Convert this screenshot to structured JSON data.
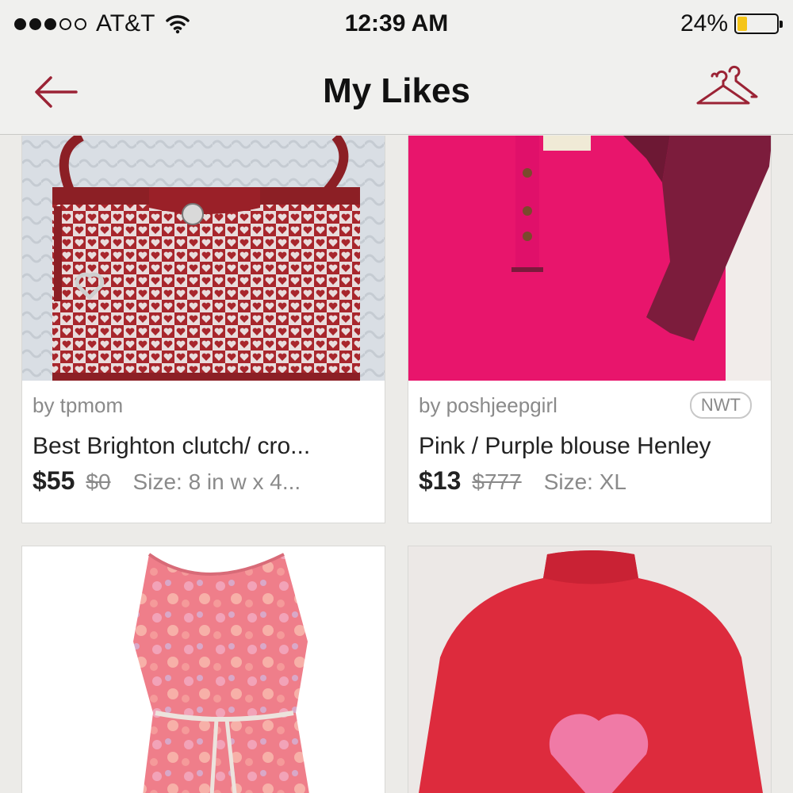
{
  "status_bar": {
    "carrier": "AT&T",
    "time": "12:39 AM",
    "battery": "24%",
    "battery_level": 0.24,
    "signal_bars": 3,
    "signal_total": 5
  },
  "header": {
    "title": "My Likes",
    "back_icon": "arrow-left-icon",
    "closet_icon": "hangers-icon"
  },
  "colors": {
    "accent": "#9b2335",
    "battery_fill": "#f5c518"
  },
  "listings": [
    {
      "seller": "by tpmom",
      "tag": "",
      "title": "Best    Brighton clutch/ cro...",
      "price": "$55",
      "original_price": "$0",
      "size": "Size: 8 in w x 4..."
    },
    {
      "seller": "by poshjeepgirl",
      "tag": "NWT",
      "title": "Pink / Purple blouse Henley",
      "price": "$13",
      "original_price": "$777",
      "size": "Size: XL"
    },
    {
      "seller": "",
      "tag": "",
      "title": "",
      "price": "",
      "original_price": "",
      "size": ""
    },
    {
      "seller": "",
      "tag": "",
      "title": "",
      "price": "",
      "original_price": "",
      "size": ""
    }
  ]
}
